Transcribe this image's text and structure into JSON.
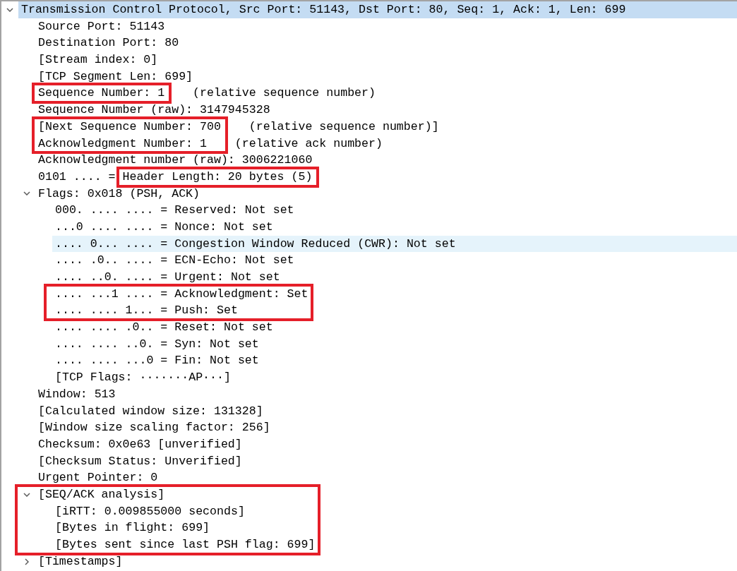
{
  "tree": [
    {
      "text": "Transmission Control Protocol, Src Port: 51143, Dst Port: 80, Seq: 1, Ack: 1, Len: 699",
      "selected": true,
      "hovered": false,
      "boxed": false,
      "expanded": true,
      "children": [
        {
          "text": "Source Port: 51143",
          "selected": false,
          "hovered": false,
          "boxed": false
        },
        {
          "text": "Destination Port: 80",
          "selected": false,
          "hovered": false,
          "boxed": false
        },
        {
          "text": "[Stream index: 0]",
          "selected": false,
          "hovered": false,
          "boxed": false
        },
        {
          "text": "[TCP Segment Len: 699]",
          "selected": false,
          "hovered": false,
          "boxed": false
        },
        {
          "text": "Sequence Number: 1",
          "note": "(relative sequence number)",
          "selected": false,
          "hovered": false,
          "boxed": true
        },
        {
          "text": "Sequence Number (raw): 3147945328",
          "selected": false,
          "hovered": false,
          "boxed": false
        },
        {
          "text": "[Next Sequence Number: 700",
          "note": "(relative sequence number)]",
          "selected": false,
          "hovered": false,
          "boxed": true
        },
        {
          "text": "Acknowledgment Number: 1",
          "note": "(relative ack number)",
          "selected": false,
          "hovered": false,
          "boxed": true
        },
        {
          "text": "Acknowledgment number (raw): 3006221060",
          "selected": false,
          "hovered": false,
          "boxed": false
        },
        {
          "bits": "0101 .... =",
          "text": "Header Length: 20 bytes (5)",
          "selected": false,
          "hovered": false,
          "boxed": true,
          "bits_boxed": false
        },
        {
          "text": "Flags: 0x018 (PSH, ACK)",
          "selected": false,
          "hovered": false,
          "boxed": false,
          "expanded": true,
          "children": [
            {
              "bits": "000. .... .... =",
              "text": "Reserved: Not set",
              "selected": false,
              "hovered": false,
              "boxed": false
            },
            {
              "bits": "...0 .... .... =",
              "text": "Nonce: Not set",
              "selected": false,
              "hovered": false,
              "boxed": false
            },
            {
              "bits": ".... 0... .... =",
              "text": "Congestion Window Reduced (CWR): Not set",
              "selected": false,
              "hovered": true,
              "boxed": false
            },
            {
              "bits": ".... .0.. .... =",
              "text": "ECN-Echo: Not set",
              "selected": false,
              "hovered": false,
              "boxed": false
            },
            {
              "bits": ".... ..0. .... =",
              "text": "Urgent: Not set",
              "selected": false,
              "hovered": false,
              "boxed": false
            },
            {
              "bits": ".... ...1 .... =",
              "text": "Acknowledgment: Set",
              "selected": false,
              "hovered": false,
              "boxed": true,
              "bits_boxed": true
            },
            {
              "bits": ".... .... 1... =",
              "text": "Push: Set",
              "selected": false,
              "hovered": false,
              "boxed": true,
              "bits_boxed": true
            },
            {
              "bits": ".... .... .0.. =",
              "text": "Reset: Not set",
              "selected": false,
              "hovered": false,
              "boxed": false
            },
            {
              "bits": ".... .... ..0. =",
              "text": "Syn: Not set",
              "selected": false,
              "hovered": false,
              "boxed": false
            },
            {
              "bits": ".... .... ...0 =",
              "text": "Fin: Not set",
              "selected": false,
              "hovered": false,
              "boxed": false
            },
            {
              "text": "[TCP Flags: ·······AP···]",
              "selected": false,
              "hovered": false,
              "boxed": false
            }
          ]
        },
        {
          "text": "Window: 513",
          "selected": false,
          "hovered": false,
          "boxed": false
        },
        {
          "text": "[Calculated window size: 131328]",
          "selected": false,
          "hovered": false,
          "boxed": false
        },
        {
          "text": "[Window size scaling factor: 256]",
          "selected": false,
          "hovered": false,
          "boxed": false
        },
        {
          "text": "Checksum: 0x0e63 [unverified]",
          "selected": false,
          "hovered": false,
          "boxed": false
        },
        {
          "text": "[Checksum Status: Unverified]",
          "selected": false,
          "hovered": false,
          "boxed": false
        },
        {
          "text": "Urgent Pointer: 0",
          "selected": false,
          "hovered": false,
          "boxed": false
        },
        {
          "text": "[SEQ/ACK analysis]",
          "selected": false,
          "hovered": false,
          "boxed": true,
          "expanded": true,
          "children": [
            {
              "text": "[iRTT: 0.009855000 seconds]",
              "selected": false,
              "hovered": false,
              "boxed": false
            },
            {
              "text": "[Bytes in flight: 699]",
              "selected": false,
              "hovered": false,
              "boxed": false
            },
            {
              "text": "[Bytes sent since last PSH flag: 699]",
              "selected": false,
              "hovered": false,
              "boxed": false
            }
          ]
        },
        {
          "text": "[Timestamps]",
          "selected": false,
          "hovered": false,
          "boxed": false,
          "expanded": false
        }
      ]
    }
  ]
}
